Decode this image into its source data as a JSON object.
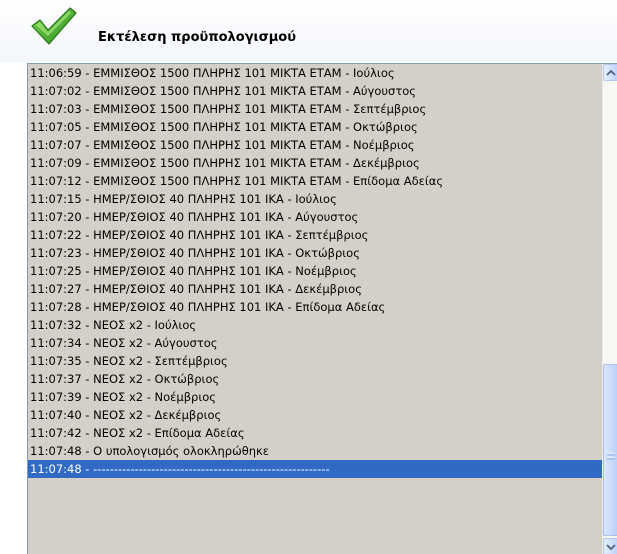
{
  "header": {
    "title": "Εκτέλεση προϋπολογισμού",
    "icon": "checkmark-icon",
    "icon_color": "#3a9b2a"
  },
  "log": {
    "lines": [
      "11:06:59 - ΕΜΜΙΣΘΟΣ 1500 ΠΛΗΡΗΣ 101 ΜΙΚΤΑ ΕΤΑΜ - Ιούλιος",
      "11:07:02 - ΕΜΜΙΣΘΟΣ 1500 ΠΛΗΡΗΣ 101 ΜΙΚΤΑ ΕΤΑΜ - Αύγουστος",
      "11:07:03 - ΕΜΜΙΣΘΟΣ 1500 ΠΛΗΡΗΣ 101 ΜΙΚΤΑ ΕΤΑΜ - Σεπτέμβριος",
      "11:07:05 - ΕΜΜΙΣΘΟΣ 1500 ΠΛΗΡΗΣ 101 ΜΙΚΤΑ ΕΤΑΜ - Οκτώβριος",
      "11:07:07 - ΕΜΜΙΣΘΟΣ 1500 ΠΛΗΡΗΣ 101 ΜΙΚΤΑ ΕΤΑΜ - Νοέμβριος",
      "11:07:09 - ΕΜΜΙΣΘΟΣ 1500 ΠΛΗΡΗΣ 101 ΜΙΚΤΑ ΕΤΑΜ - Δεκέμβριος",
      "11:07:12 - ΕΜΜΙΣΘΟΣ 1500 ΠΛΗΡΗΣ 101 ΜΙΚΤΑ ΕΤΑΜ - Επίδομα Αδείας",
      "11:07:15 - ΗΜΕΡ/ΣΘΙΟΣ 40 ΠΛΗΡΗΣ 101 ΙΚΑ - Ιούλιος",
      "11:07:20 - ΗΜΕΡ/ΣΘΙΟΣ 40 ΠΛΗΡΗΣ 101 ΙΚΑ - Αύγουστος",
      "11:07:22 - ΗΜΕΡ/ΣΘΙΟΣ 40 ΠΛΗΡΗΣ 101 ΙΚΑ - Σεπτέμβριος",
      "11:07:23 - ΗΜΕΡ/ΣΘΙΟΣ 40 ΠΛΗΡΗΣ 101 ΙΚΑ - Οκτώβριος",
      "11:07:25 - ΗΜΕΡ/ΣΘΙΟΣ 40 ΠΛΗΡΗΣ 101 ΙΚΑ - Νοέμβριος",
      "11:07:27 - ΗΜΕΡ/ΣΘΙΟΣ 40 ΠΛΗΡΗΣ 101 ΙΚΑ - Δεκέμβριος",
      "11:07:28 - ΗΜΕΡ/ΣΘΙΟΣ 40 ΠΛΗΡΗΣ 101 ΙΚΑ - Επίδομα Αδείας",
      "11:07:32 - ΝΕΟΣ x2 - Ιούλιος",
      "11:07:34 - ΝΕΟΣ x2 - Αύγουστος",
      "11:07:35 - ΝΕΟΣ x2 - Σεπτέμβριος",
      "11:07:37 - ΝΕΟΣ x2 - Οκτώβριος",
      "11:07:39 - ΝΕΟΣ x2 - Νοέμβριος",
      "11:07:40 - ΝΕΟΣ x2 - Δεκέμβριος",
      "11:07:42 - ΝΕΟΣ x2 - Επίδομα Αδείας",
      "11:07:48 - Ο υπολογισμός ολοκληρώθηκε",
      "11:07:48 - ---------------------------------------------------------"
    ],
    "selected_color": "#316ac5"
  },
  "scrollbar": {
    "up_icon": "scroll-up-arrow-icon",
    "down_icon": "scroll-down-arrow-icon"
  }
}
